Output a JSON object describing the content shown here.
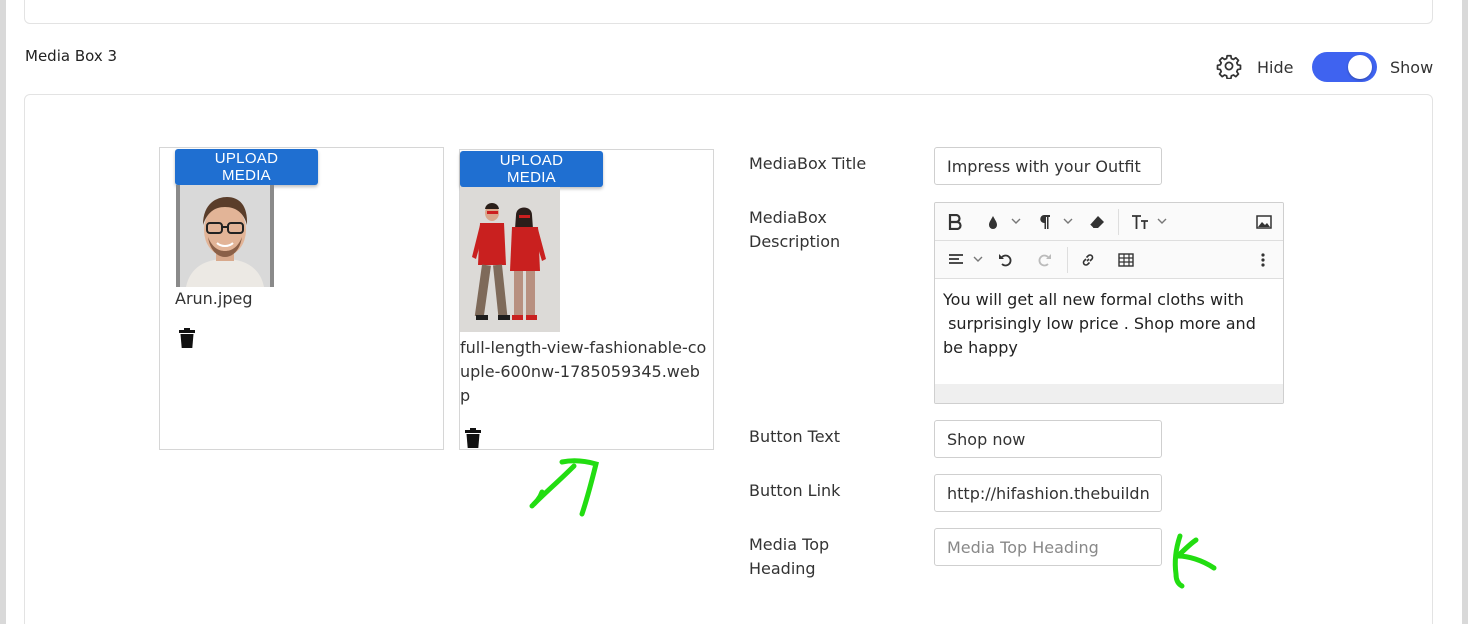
{
  "section": {
    "title": "Media Box 3",
    "hide_label": "Hide",
    "show_label": "Show",
    "toggle_state": "on",
    "accent_color": "#3f63f0"
  },
  "media_items": [
    {
      "upload_label": "UPLOAD MEDIA",
      "file_name": "Arun.jpeg"
    },
    {
      "upload_label": "UPLOAD MEDIA",
      "file_name": "full-length-view-fashionable-couple-600nw-1785059345.webp"
    }
  ],
  "form": {
    "title_label": "MediaBox Title",
    "title_value": "Impress with your Outfit",
    "description_label": "MediaBox Description",
    "description_value": "You will get all new formal cloths with\n surprisingly low price . Shop more and be happy",
    "button_text_label": "Button Text",
    "button_text_value": "Shop now",
    "button_link_label": "Button Link",
    "button_link_value": "http://hifashion.thebuildn",
    "top_heading_label": "Media Top Heading",
    "top_heading_placeholder": "Media Top Heading"
  },
  "editor_toolbar": {
    "row1": [
      "bold-icon",
      "text-color-icon",
      "paragraph-icon",
      "eraser-icon",
      "text-size-icon",
      "image-icon"
    ],
    "row2": [
      "align-icon",
      "undo-icon",
      "redo-icon",
      "link-icon",
      "table-icon",
      "more-icon"
    ],
    "button_color": "#1f6fd1"
  }
}
